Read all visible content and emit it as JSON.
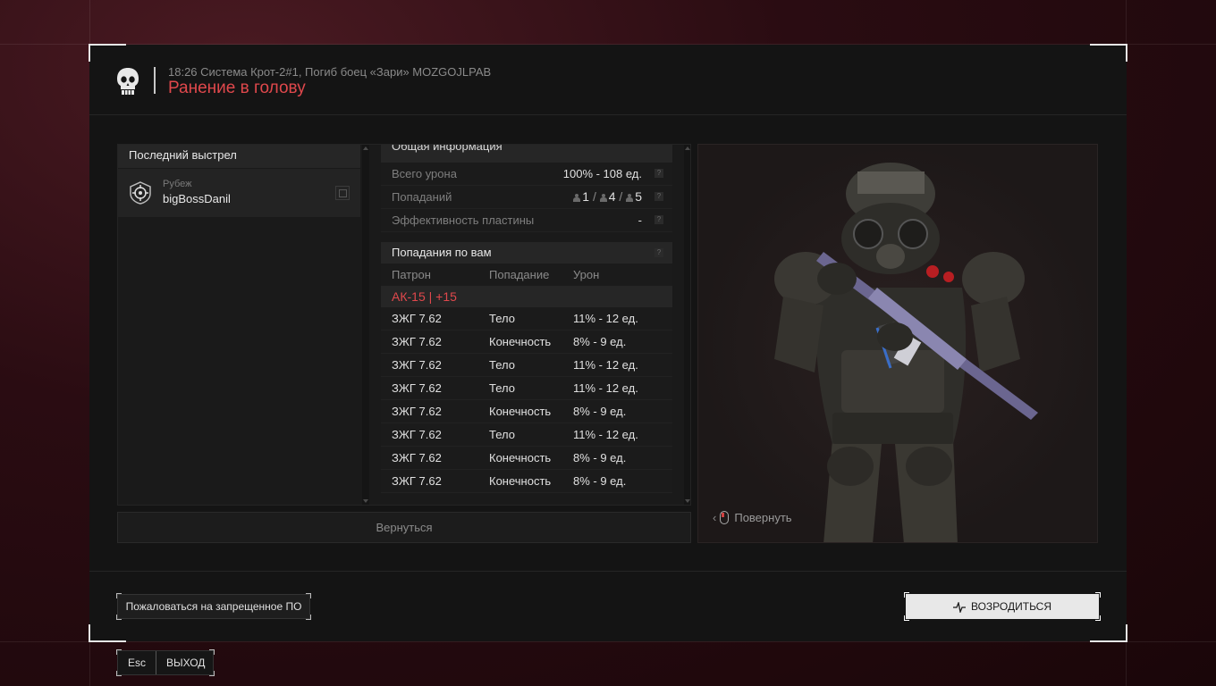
{
  "header": {
    "subtitle": "18:26 Система Крот-2#1, Погиб боец «Зари» MOZGOJLPAB",
    "title": "Ранение в голову"
  },
  "last_shot": {
    "heading": "Последний выстрел",
    "rank": "Рубеж",
    "nickname": "bigBossDanil"
  },
  "general_info": {
    "heading": "Общая информация",
    "rows": [
      {
        "label": "Всего урона",
        "value": "100% - 108 ед."
      },
      {
        "label": "Попаданий",
        "value_a": "1",
        "value_b": "4",
        "value_c": "5"
      },
      {
        "label": "Эффективность пластины",
        "value": "-"
      }
    ]
  },
  "hits": {
    "heading": "Попадания по вам",
    "columns": [
      "Патрон",
      "Попадание",
      "Урон"
    ],
    "weapon": "АК-15 | +15",
    "rows": [
      {
        "ammo": "ЗЖГ 7.62",
        "zone": "Тело",
        "damage": "11% - 12 ед."
      },
      {
        "ammo": "ЗЖГ 7.62",
        "zone": "Конечность",
        "damage": "8% - 9 ед."
      },
      {
        "ammo": "ЗЖГ 7.62",
        "zone": "Тело",
        "damage": "11% - 12 ед."
      },
      {
        "ammo": "ЗЖГ 7.62",
        "zone": "Тело",
        "damage": "11% - 12 ед."
      },
      {
        "ammo": "ЗЖГ 7.62",
        "zone": "Конечность",
        "damage": "8% - 9 ед."
      },
      {
        "ammo": "ЗЖГ 7.62",
        "zone": "Тело",
        "damage": "11% - 12 ед."
      },
      {
        "ammo": "ЗЖГ 7.62",
        "zone": "Конечность",
        "damage": "8% - 9 ед."
      },
      {
        "ammo": "ЗЖГ 7.62",
        "zone": "Конечность",
        "damage": "8% - 9 ед."
      }
    ]
  },
  "back_label": "Вернуться",
  "rotate_label": "Повернуть",
  "footer": {
    "report_label": "Пожаловаться на запрещенное ПО",
    "respawn_label": "ВОЗРОДИТЬСЯ",
    "esc_key": "Esc",
    "exit_label": "ВЫХОД"
  },
  "colors": {
    "accent": "#e0484c",
    "panel": "#1a1a1a",
    "background": "#2a0c12"
  }
}
